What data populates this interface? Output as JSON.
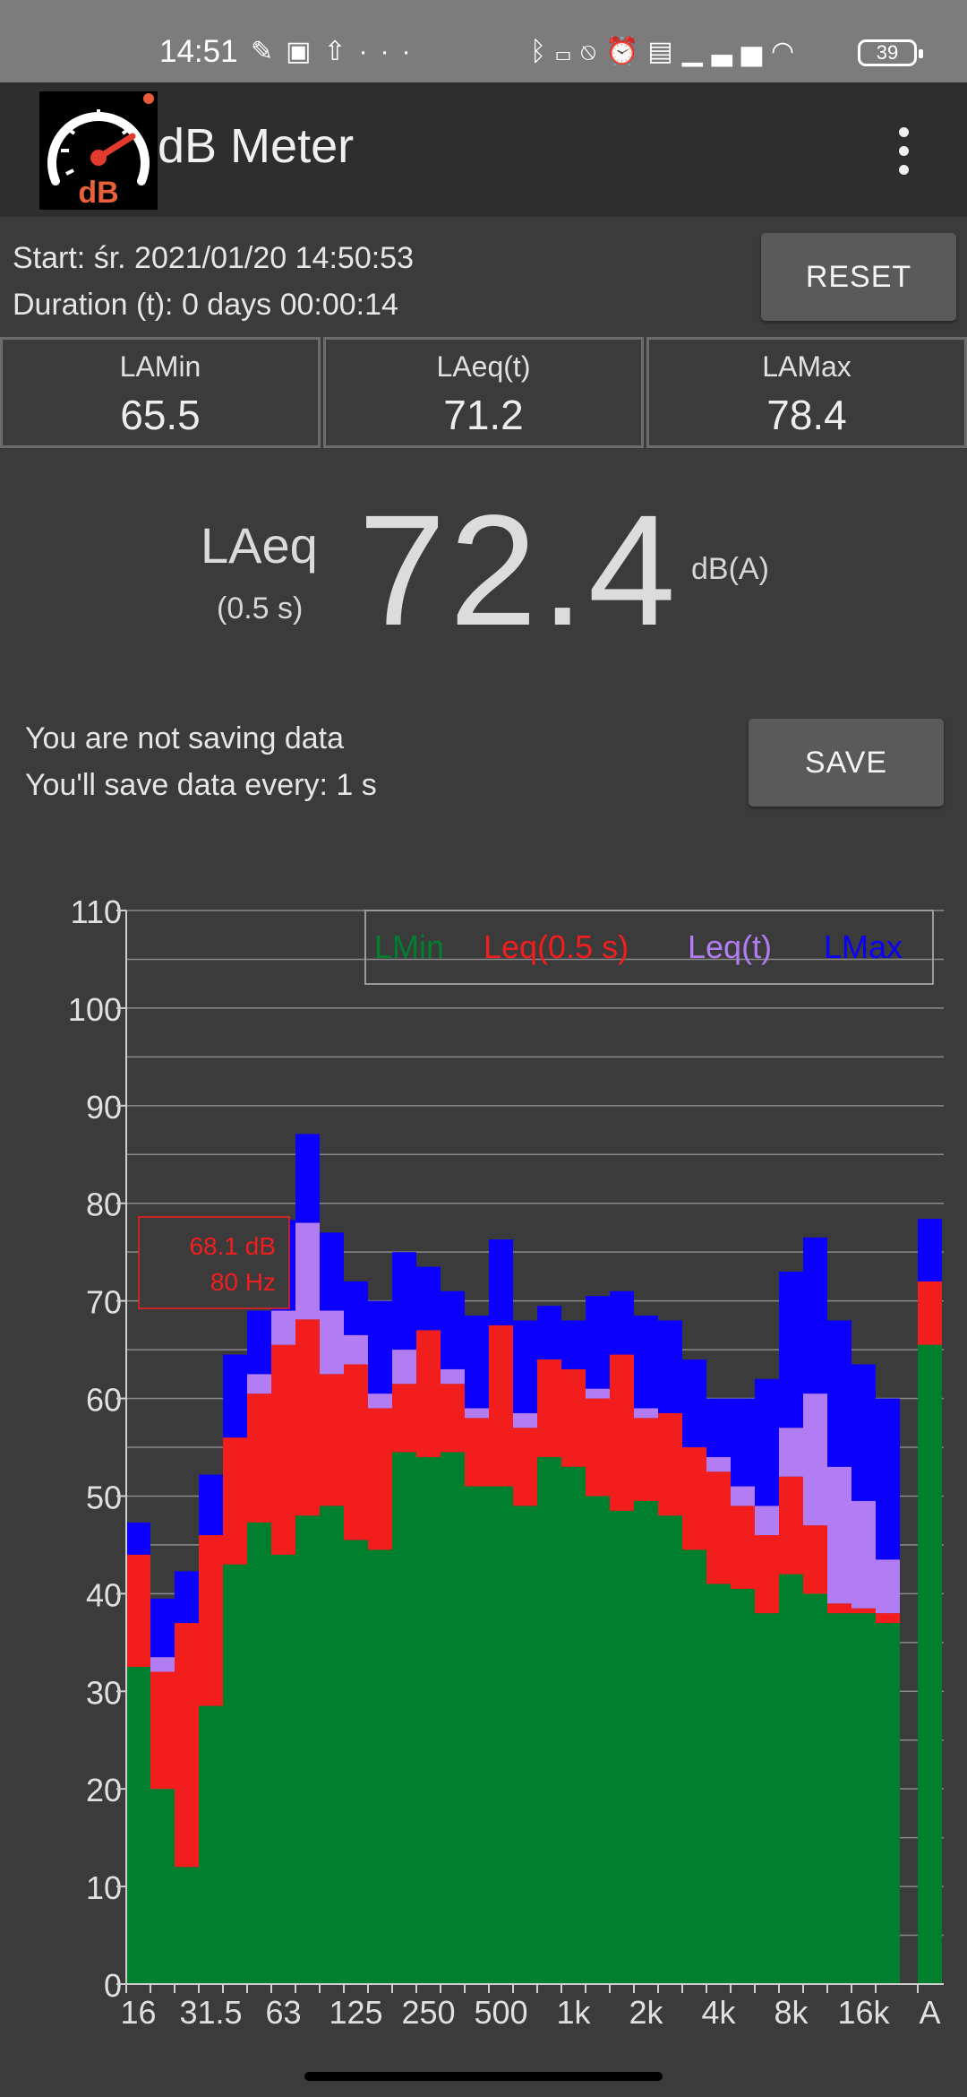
{
  "status_bar": {
    "time": "14:51",
    "left_icons": [
      "pen-icon",
      "cast-icon",
      "upload-icon",
      "more-icon"
    ],
    "right_icons": [
      "bluetooth-icon",
      "vibrate-icon",
      "mute-icon",
      "alarm-icon",
      "volte-icon",
      "signal-icon",
      "wifi-icon"
    ],
    "battery": "39"
  },
  "app": {
    "title": "dB Meter",
    "logo_text": "dB"
  },
  "session": {
    "start": "Start: śr. 2021/01/20 14:50:53",
    "duration": "Duration (t): 0 days 00:00:14",
    "reset_label": "RESET"
  },
  "stats": [
    {
      "label": "LAMin",
      "value": "65.5"
    },
    {
      "label": "LAeq(t)",
      "value": "71.2"
    },
    {
      "label": "LAMax",
      "value": "78.4"
    }
  ],
  "current": {
    "label": "LAeq",
    "sub": "(0.5 s)",
    "value": "72.4",
    "unit": "dB(A)"
  },
  "saving": {
    "line1": "You are not saving data",
    "line2": "You'll save data every: 1 s",
    "save_label": "SAVE"
  },
  "colors": {
    "lmin": "#007f2e",
    "leq_short": "#f21e1e",
    "leq_t": "#b27df3",
    "lmax": "#0a00fb"
  },
  "chart_data": {
    "type": "bar",
    "ylim": [
      0,
      110
    ],
    "yticks": [
      0,
      10,
      20,
      30,
      40,
      50,
      60,
      70,
      80,
      90,
      100,
      110
    ],
    "x_tick_labels": [
      "16",
      "31.5",
      "63",
      "125",
      "250",
      "500",
      "1k",
      "2k",
      "4k",
      "8k",
      "16k",
      "A"
    ],
    "legend": [
      "LMin",
      "Leq(0.5 s)",
      "Leq(t)",
      "LMax"
    ],
    "tooltip": {
      "line1": "68.1 dB",
      "line2": "80 Hz"
    },
    "bands": [
      {
        "f": "16",
        "lmin": 32.5,
        "leq": 44.0,
        "leqt": 44.0,
        "lmax": 47.3
      },
      {
        "f": "20",
        "lmin": 20.0,
        "leq": 32.0,
        "leqt": 33.5,
        "lmax": 39.5
      },
      {
        "f": "25",
        "lmin": 12.0,
        "leq": 37.0,
        "leqt": 37.0,
        "lmax": 42.3
      },
      {
        "f": "31.5",
        "lmin": 28.5,
        "leq": 46.0,
        "leqt": 46.0,
        "lmax": 52.2
      },
      {
        "f": "40",
        "lmin": 43.0,
        "leq": 56.0,
        "leqt": 56.0,
        "lmax": 64.5
      },
      {
        "f": "50",
        "lmin": 47.3,
        "leq": 60.5,
        "leqt": 62.5,
        "lmax": 69.0
      },
      {
        "f": "63",
        "lmin": 44.0,
        "leq": 65.5,
        "leqt": 69.0,
        "lmax": 78.3
      },
      {
        "f": "80",
        "lmin": 48.0,
        "leq": 68.1,
        "leqt": 78.0,
        "lmax": 87.1
      },
      {
        "f": "100",
        "lmin": 49.0,
        "leq": 62.5,
        "leqt": 69.0,
        "lmax": 77.0
      },
      {
        "f": "125",
        "lmin": 45.5,
        "leq": 63.5,
        "leqt": 66.5,
        "lmax": 72.0
      },
      {
        "f": "160",
        "lmin": 44.5,
        "leq": 59.0,
        "leqt": 60.5,
        "lmax": 70.0
      },
      {
        "f": "200",
        "lmin": 54.5,
        "leq": 61.5,
        "leqt": 65.0,
        "lmax": 75.0
      },
      {
        "f": "250",
        "lmin": 54.0,
        "leq": 67.0,
        "leqt": 67.0,
        "lmax": 73.5
      },
      {
        "f": "315",
        "lmin": 54.5,
        "leq": 61.5,
        "leqt": 63.0,
        "lmax": 71.0
      },
      {
        "f": "400",
        "lmin": 51.0,
        "leq": 58.0,
        "leqt": 59.0,
        "lmax": 68.5
      },
      {
        "f": "500",
        "lmin": 51.0,
        "leq": 67.5,
        "leqt": 67.5,
        "lmax": 76.3
      },
      {
        "f": "630",
        "lmin": 49.0,
        "leq": 57.0,
        "leqt": 58.5,
        "lmax": 68.0
      },
      {
        "f": "800",
        "lmin": 54.0,
        "leq": 64.0,
        "leqt": 64.0,
        "lmax": 69.5
      },
      {
        "f": "1k",
        "lmin": 53.0,
        "leq": 63.0,
        "leqt": 63.0,
        "lmax": 68.0
      },
      {
        "f": "1.25k",
        "lmin": 50.0,
        "leq": 60.0,
        "leqt": 61.0,
        "lmax": 70.5
      },
      {
        "f": "1.6k",
        "lmin": 48.5,
        "leq": 64.5,
        "leqt": 64.5,
        "lmax": 71.0
      },
      {
        "f": "2k",
        "lmin": 49.5,
        "leq": 58.0,
        "leqt": 59.0,
        "lmax": 68.5
      },
      {
        "f": "2.5k",
        "lmin": 48.0,
        "leq": 58.5,
        "leqt": 58.5,
        "lmax": 68.0
      },
      {
        "f": "3.15k",
        "lmin": 44.5,
        "leq": 55.0,
        "leqt": 55.0,
        "lmax": 64.0
      },
      {
        "f": "4k",
        "lmin": 41.0,
        "leq": 52.5,
        "leqt": 54.0,
        "lmax": 60.0
      },
      {
        "f": "5k",
        "lmin": 40.5,
        "leq": 49.0,
        "leqt": 51.0,
        "lmax": 60.0
      },
      {
        "f": "6.3k",
        "lmin": 38.0,
        "leq": 46.0,
        "leqt": 49.0,
        "lmax": 62.0
      },
      {
        "f": "8k",
        "lmin": 42.0,
        "leq": 52.0,
        "leqt": 57.0,
        "lmax": 73.0
      },
      {
        "f": "10k",
        "lmin": 40.0,
        "leq": 47.0,
        "leqt": 60.5,
        "lmax": 76.5
      },
      {
        "f": "12.5k",
        "lmin": 38.0,
        "leq": 39.0,
        "leqt": 53.0,
        "lmax": 68.0
      },
      {
        "f": "16k",
        "lmin": 38.0,
        "leq": 38.5,
        "leqt": 49.5,
        "lmax": 63.5
      },
      {
        "f": "20k",
        "lmin": 37.0,
        "leq": 38.0,
        "leqt": 43.5,
        "lmax": 60.0
      },
      {
        "f": "A",
        "lmin": 65.5,
        "leq": 72.0,
        "leqt": 72.0,
        "lmax": 78.4
      }
    ]
  }
}
